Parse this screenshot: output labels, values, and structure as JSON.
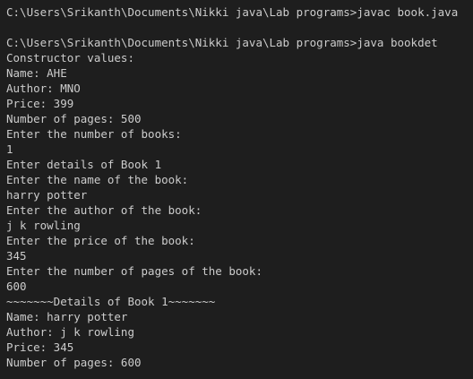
{
  "terminal": {
    "lines": [
      "C:\\Users\\Srikanth\\Documents\\Nikki java\\Lab programs>javac book.java",
      "",
      "C:\\Users\\Srikanth\\Documents\\Nikki java\\Lab programs>java bookdet",
      "Constructor values:",
      "Name: AHE",
      "Author: MNO",
      "Price: 399",
      "Number of pages: 500",
      "Enter the number of books:",
      "1",
      "Enter details of Book 1",
      "Enter the name of the book:",
      "harry potter",
      "Enter the author of the book:",
      "j k rowling",
      "Enter the price of the book:",
      "345",
      "Enter the number of pages of the book:",
      "600",
      "~~~~~~~Details of Book 1~~~~~~~",
      "Name: harry potter",
      "Author: j k rowling",
      "Price: 345",
      "Number of pages: 600"
    ]
  }
}
